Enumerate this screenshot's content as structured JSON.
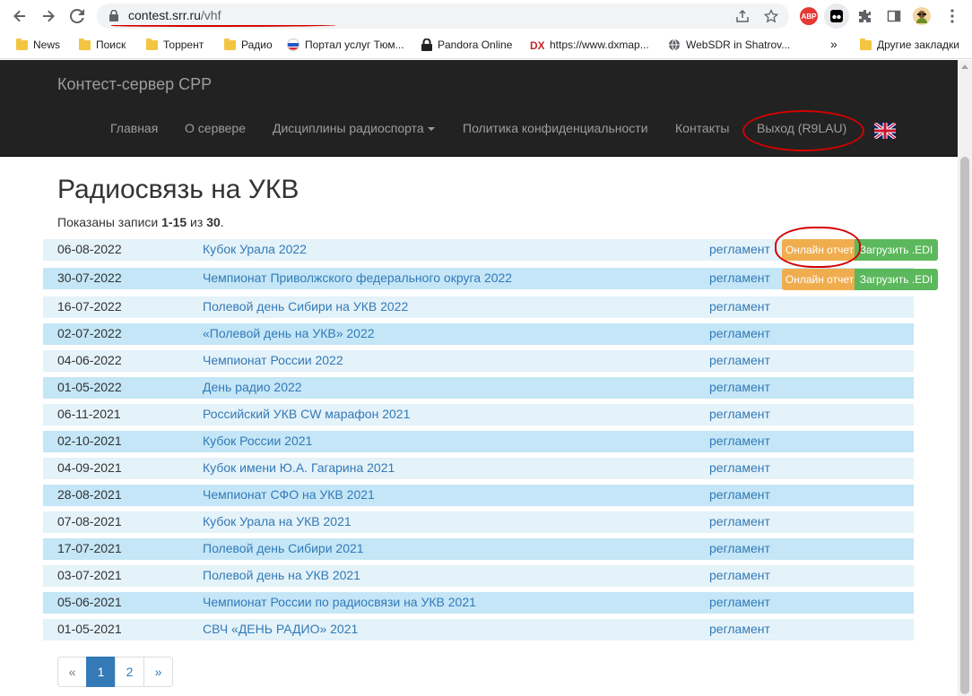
{
  "browser": {
    "url_host": "contest.srr.ru",
    "url_path": "/vhf",
    "bookmarks": [
      "News",
      "Поиск",
      "Торрент",
      "Радио",
      "Портал услуг Тюм...",
      "Pandora Online",
      "https://www.dxmap...",
      "WebSDR in Shatrov..."
    ],
    "more_bookmarks_chevron": "»",
    "other_bookmarks": "Другие закладки",
    "abp_label": "ABP"
  },
  "site": {
    "brand": "Контест-сервер СРР",
    "menu": {
      "home": "Главная",
      "about": "О сервере",
      "disciplines": "Дисциплины радиоспорта",
      "privacy": "Политика конфиденциальности",
      "contacts": "Контакты",
      "logout": "Выход (R9LAU)"
    }
  },
  "main": {
    "title": "Радиосвязь на УКВ",
    "summary_prefix": "Показаны записи ",
    "summary_range": "1-15",
    "summary_mid": " из ",
    "summary_total": "30",
    "summary_suffix": ".",
    "reglament_label": "регламент",
    "online_report_label": "Онлайн отчет",
    "upload_edi_label": "Загрузить .EDI",
    "contests": [
      {
        "date": "06-08-2022",
        "name": "Кубок Урала 2022"
      },
      {
        "date": "30-07-2022",
        "name": "Чемпионат Приволжского федерального округа 2022"
      },
      {
        "date": "16-07-2022",
        "name": "Полевой день Сибири на УКВ 2022"
      },
      {
        "date": "02-07-2022",
        "name": "«Полевой день на УКВ» 2022"
      },
      {
        "date": "04-06-2022",
        "name": "Чемпионат России 2022"
      },
      {
        "date": "01-05-2022",
        "name": "День радио 2022"
      },
      {
        "date": "06-11-2021",
        "name": "Российский УКВ CW марафон 2021"
      },
      {
        "date": "02-10-2021",
        "name": "Кубок России 2021"
      },
      {
        "date": "04-09-2021",
        "name": "Кубок имени Ю.А. Гагарина 2021"
      },
      {
        "date": "28-08-2021",
        "name": "Чемпионат СФО на УКВ 2021"
      },
      {
        "date": "07-08-2021",
        "name": "Кубок Урала на УКВ 2021"
      },
      {
        "date": "17-07-2021",
        "name": "Полевой день Сибири 2021"
      },
      {
        "date": "03-07-2021",
        "name": "Полевой день на УКВ 2021"
      },
      {
        "date": "05-06-2021",
        "name": "Чемпионат России по радиосвязи на УКВ 2021"
      },
      {
        "date": "01-05-2021",
        "name": "СВЧ «ДЕНЬ РАДИО» 2021"
      }
    ]
  },
  "pagination": {
    "prev": "«",
    "pages": [
      "1",
      "2"
    ],
    "next": "»",
    "current": "1"
  },
  "colors": {
    "navbar_bg": "#222222",
    "link": "#337ab7",
    "row_alt": "#c4e6f7",
    "row_plain": "#e4f2f9",
    "warning": "#f0ad4e",
    "success": "#5cb85c",
    "annotation_red": "#d40000"
  }
}
